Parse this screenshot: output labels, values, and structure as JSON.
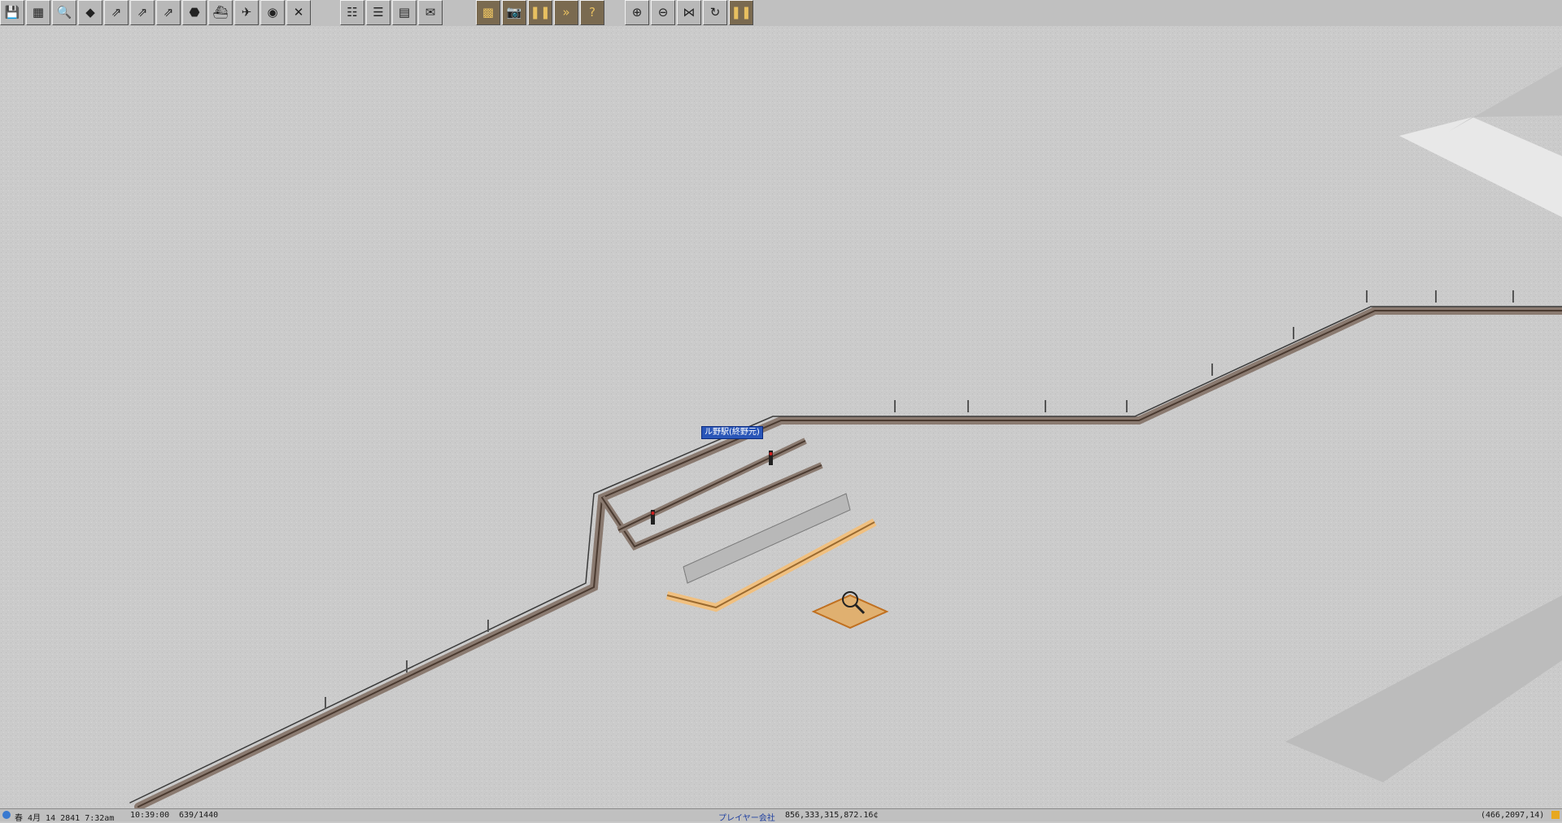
{
  "toolbar": {
    "tools": [
      {
        "name": "save-icon",
        "glyph": "💾"
      },
      {
        "name": "map-icon",
        "glyph": "▦"
      },
      {
        "name": "inspect-magnifier-icon",
        "glyph": "🔍"
      },
      {
        "name": "terrain-slope-icon",
        "glyph": "◆"
      },
      {
        "name": "rail-tool-icon",
        "glyph": "⇗"
      },
      {
        "name": "monorail-tool-icon",
        "glyph": "⇗"
      },
      {
        "name": "tram-tool-icon",
        "glyph": "⇗"
      },
      {
        "name": "road-tool-icon",
        "glyph": "⬣"
      },
      {
        "name": "ship-tool-icon",
        "glyph": "⛴"
      },
      {
        "name": "airport-tool-icon",
        "glyph": "✈"
      },
      {
        "name": "special-tool-icon",
        "glyph": "◉"
      },
      {
        "name": "remove-tool-icon",
        "glyph": "✕"
      },
      {
        "name": "line-management-icon",
        "glyph": "☷"
      },
      {
        "name": "list-icon",
        "glyph": "☰"
      },
      {
        "name": "finance-icon",
        "glyph": "▤"
      },
      {
        "name": "mail-icon",
        "glyph": "✉"
      },
      {
        "name": "minimap-icon",
        "glyph": "▩"
      },
      {
        "name": "screenshot-camera-icon",
        "glyph": "📷"
      },
      {
        "name": "pause-icon",
        "glyph": "❚❚"
      },
      {
        "name": "fast-forward-icon",
        "glyph": "»"
      },
      {
        "name": "help-icon",
        "glyph": "?"
      },
      {
        "name": "zoom-in-icon",
        "glyph": "⊕"
      },
      {
        "name": "zoom-out-icon",
        "glyph": "⊖"
      },
      {
        "name": "grid-toggle-icon",
        "glyph": "⋈"
      },
      {
        "name": "rotate-view-icon",
        "glyph": "↻"
      },
      {
        "name": "pause-right-icon",
        "glyph": "❚❚"
      }
    ]
  },
  "map": {
    "station_name": "ル野駅(終野元)"
  },
  "status": {
    "date": "春 4月 14 2841   7:32am",
    "clock": "10:39:00",
    "ticks": "639/1440",
    "company": "プレイヤー会社",
    "money": "856,333,315,872.16¢",
    "coords": "(466,2097,14)"
  },
  "colors": {
    "snow": "#cbcbcb",
    "rail": "#4a3a30",
    "catenary": "#3a3a3a",
    "construction": "#f0b060",
    "station_label_bg": "#2a56b8"
  }
}
